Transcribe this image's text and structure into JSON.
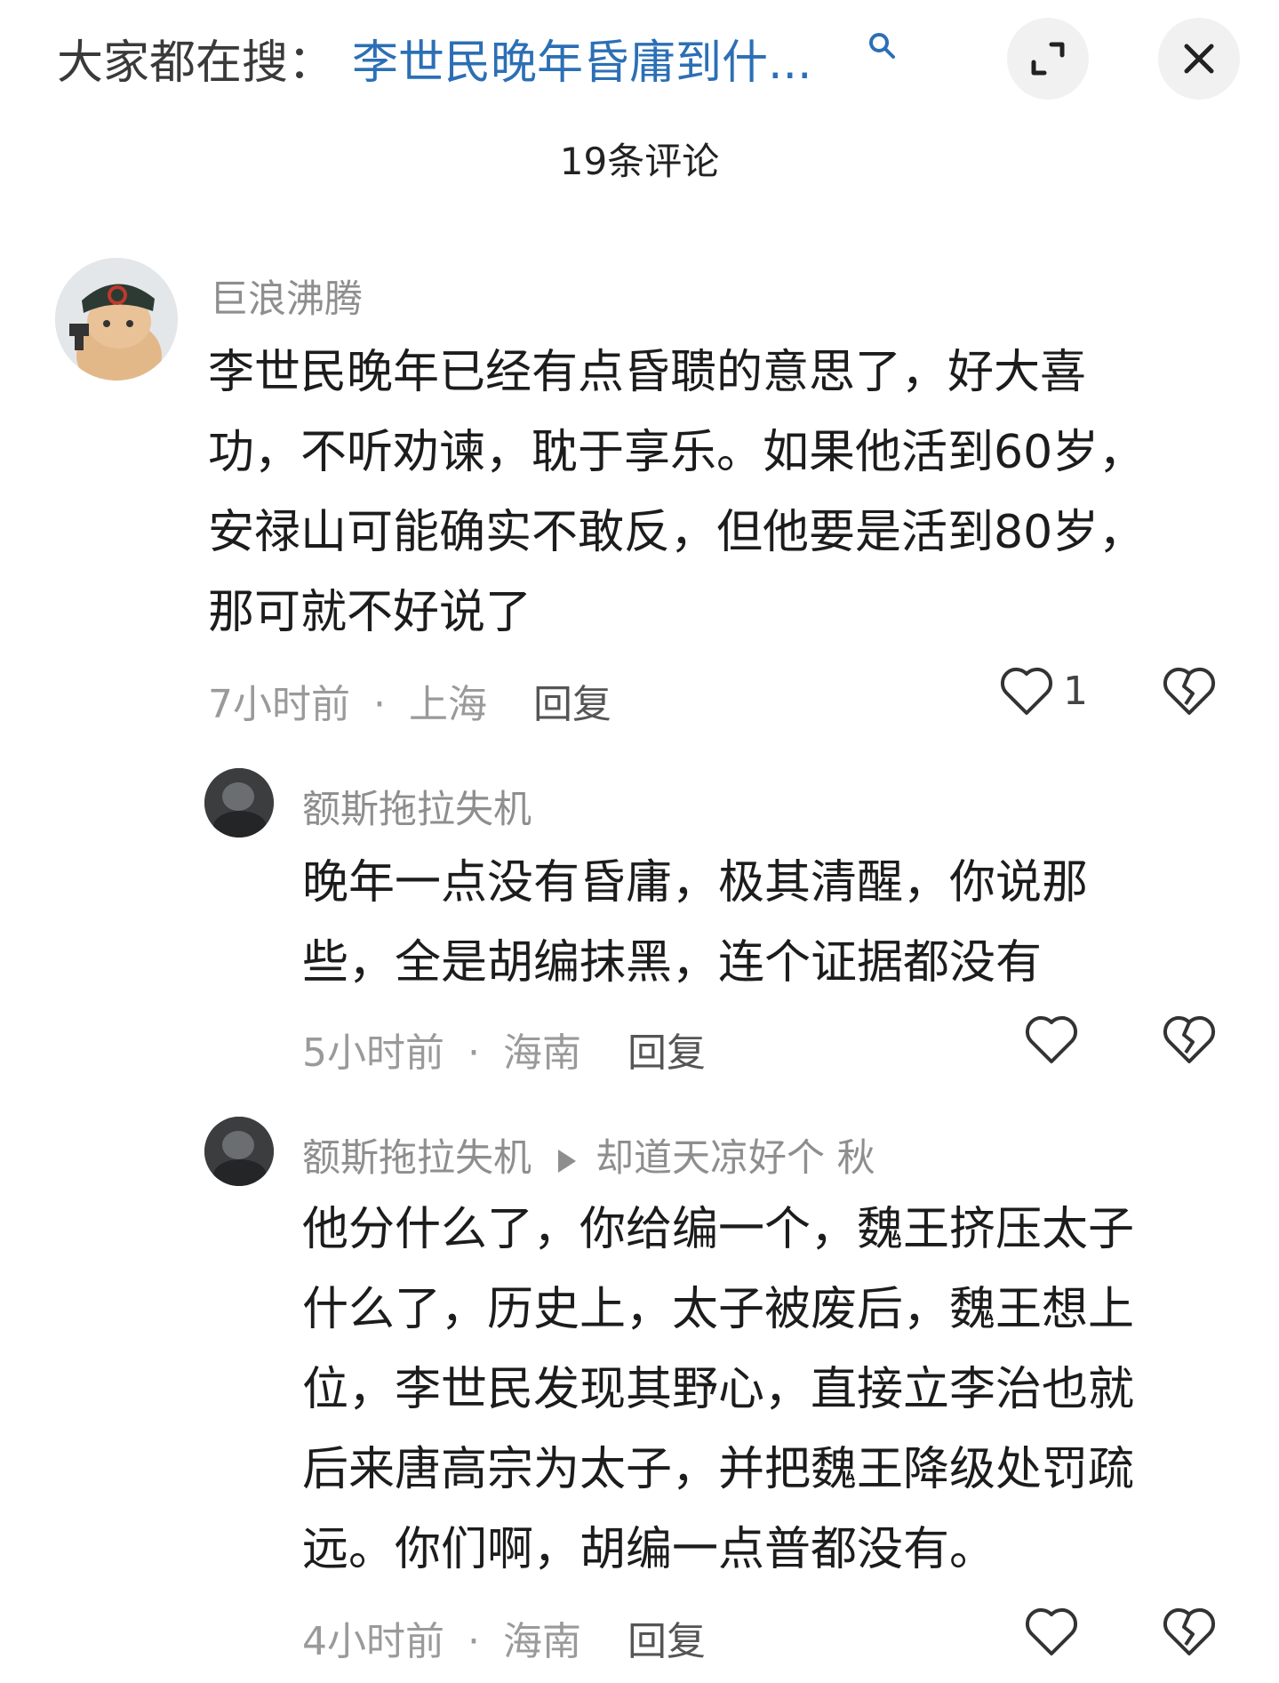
{
  "header": {
    "search_prefix": "大家都在搜：",
    "search_query": "李世民晚年昏庸到什...",
    "expand_icon": "expand-icon",
    "close_icon": "close-icon"
  },
  "comment_count": "19条评论",
  "comments": [
    {
      "username": "巨浪沸腾",
      "lines": [
        "李世民晚年已经有点昏聩的意思了，好大喜",
        "功，不听劝谏，耽于享乐。如果他活到60岁，",
        "安禄山可能确实不敢反，但他要是活到80岁，",
        "那可就不好说了"
      ],
      "time": "7小时前",
      "location": "上海",
      "reply": "回复",
      "likes": "1"
    },
    {
      "username": "额斯拖拉失机",
      "lines": [
        "晚年一点没有昏庸，极其清醒，你说那",
        "些，全是胡编抹黑，连个证据都没有"
      ],
      "time": "5小时前",
      "location": "海南",
      "reply": "回复"
    },
    {
      "username": "额斯拖拉失机",
      "reply_to": "却道天凉好个 秋",
      "lines": [
        "他分什么了，你给编一个，魏王挤压太子",
        "什么了，历史上，太子被废后，魏王想上",
        "位，李世民发现其野心，直接立李治也就",
        "后来唐高宗为太子，并把魏王降级处罚疏",
        "远。你们啊，胡编一点普都没有。"
      ],
      "time": "4小时前",
      "location": "海南",
      "reply": "回复"
    }
  ]
}
